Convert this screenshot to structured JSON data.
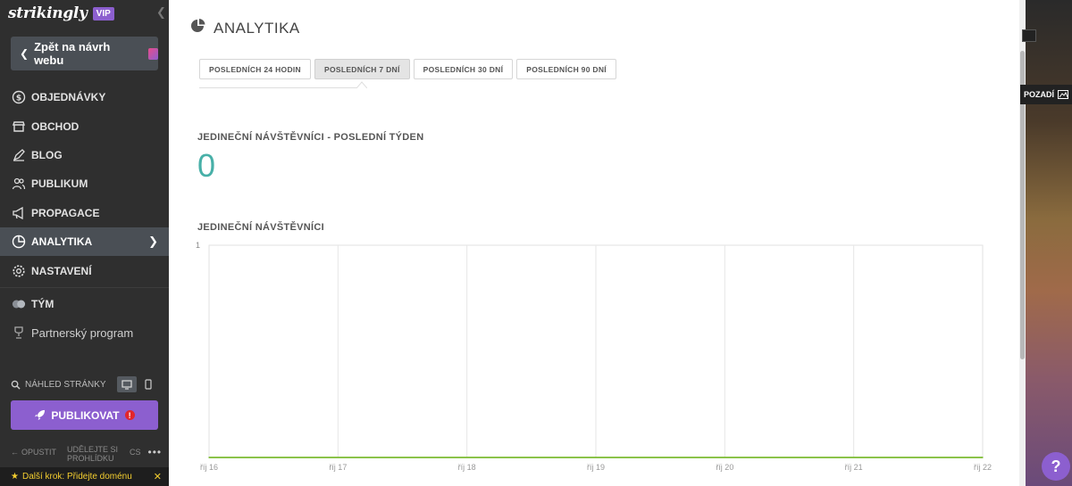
{
  "sidebar": {
    "brand": "strikingly",
    "vip": "VIP",
    "back_label": "Zpět na návrh webu",
    "items": [
      {
        "label": "OBJEDNÁVKY",
        "icon": "dollar-circle-icon"
      },
      {
        "label": "OBCHOD",
        "icon": "store-icon"
      },
      {
        "label": "BLOG",
        "icon": "pen-icon"
      },
      {
        "label": "PUBLIKUM",
        "icon": "users-icon"
      },
      {
        "label": "PROPAGACE",
        "icon": "megaphone-icon"
      },
      {
        "label": "ANALYTIKA",
        "icon": "pie-chart-icon"
      },
      {
        "label": "NASTAVENÍ",
        "icon": "gear-icon"
      },
      {
        "label": "TÝM",
        "icon": "team-icon"
      },
      {
        "label": "Partnerský program",
        "icon": "trophy-icon"
      }
    ],
    "preview_label": "NÁHLED STRÁNKY",
    "publish_label": "PUBLIKOVAT",
    "exit_label": "OPUSTIT",
    "recommend_label": "UDĚLEJTE SI PROHLÍDKU",
    "lang_label": "CS",
    "next_step": "Další krok: Přidejte doménu"
  },
  "main": {
    "title": "ANALYTIKA",
    "tabs": [
      {
        "label": "POSLEDNÍCH 24 HODIN"
      },
      {
        "label": "POSLEDNÍCH 7 DNÍ"
      },
      {
        "label": "POSLEDNÍCH 30 DNÍ"
      },
      {
        "label": "POSLEDNÍCH 90 DNÍ"
      }
    ],
    "active_tab": "POSLEDNÍCH 7 DNÍ",
    "unique_week_label": "JEDINEČNÍ NÁVŠTĚVNÍCI - POSLEDNÍ TÝDEN",
    "unique_week_value": "0",
    "chart_label": "JEDINEČNÍ NÁVŠTĚVNÍCI"
  },
  "right_strip": {
    "bg_label": "POZADÍ"
  },
  "help_label": "?",
  "chart_data": {
    "type": "line",
    "title": "",
    "xlabel": "",
    "ylabel": "",
    "categories": [
      "říj 16",
      "říj 17",
      "říj 18",
      "říj 19",
      "říj 20",
      "říj 21",
      "říj 22"
    ],
    "ylim": [
      0,
      1
    ],
    "y_ticks": [
      1
    ],
    "grid": true,
    "series": [
      {
        "color": "#8bc34a",
        "values": [
          0,
          0,
          0,
          0,
          0,
          0,
          0
        ]
      }
    ]
  },
  "colors": {
    "accent": "#8c5fcf",
    "number": "#48b0a8",
    "line": "#8bc34a"
  }
}
